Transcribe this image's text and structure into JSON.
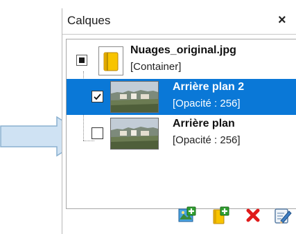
{
  "panel": {
    "title": "Calques",
    "close_symbol": "×"
  },
  "layers": [
    {
      "name": "Nuages_original.jpg",
      "detail": "[Container]",
      "icon": "folder-icon",
      "selected": false,
      "toggle": "tristate"
    },
    {
      "name": "Arrière plan 2",
      "detail": "[Opacité : 256]",
      "icon": "landscape-thumbnail",
      "selected": true,
      "checked": true
    },
    {
      "name": "Arrière plan",
      "detail": "[Opacité : 256]",
      "icon": "landscape-thumbnail",
      "selected": false,
      "checked": false
    }
  ],
  "toolbar": {
    "buttons": [
      {
        "icon": "add-image-layer-icon"
      },
      {
        "icon": "add-container-icon"
      },
      {
        "icon": "delete-icon"
      },
      {
        "icon": "layer-properties-icon"
      }
    ]
  },
  "colors": {
    "selection": "#0a78d7",
    "arrow_fill": "#cfe2f3",
    "arrow_stroke": "#8ab0d0",
    "delete": "#e01b1b"
  }
}
